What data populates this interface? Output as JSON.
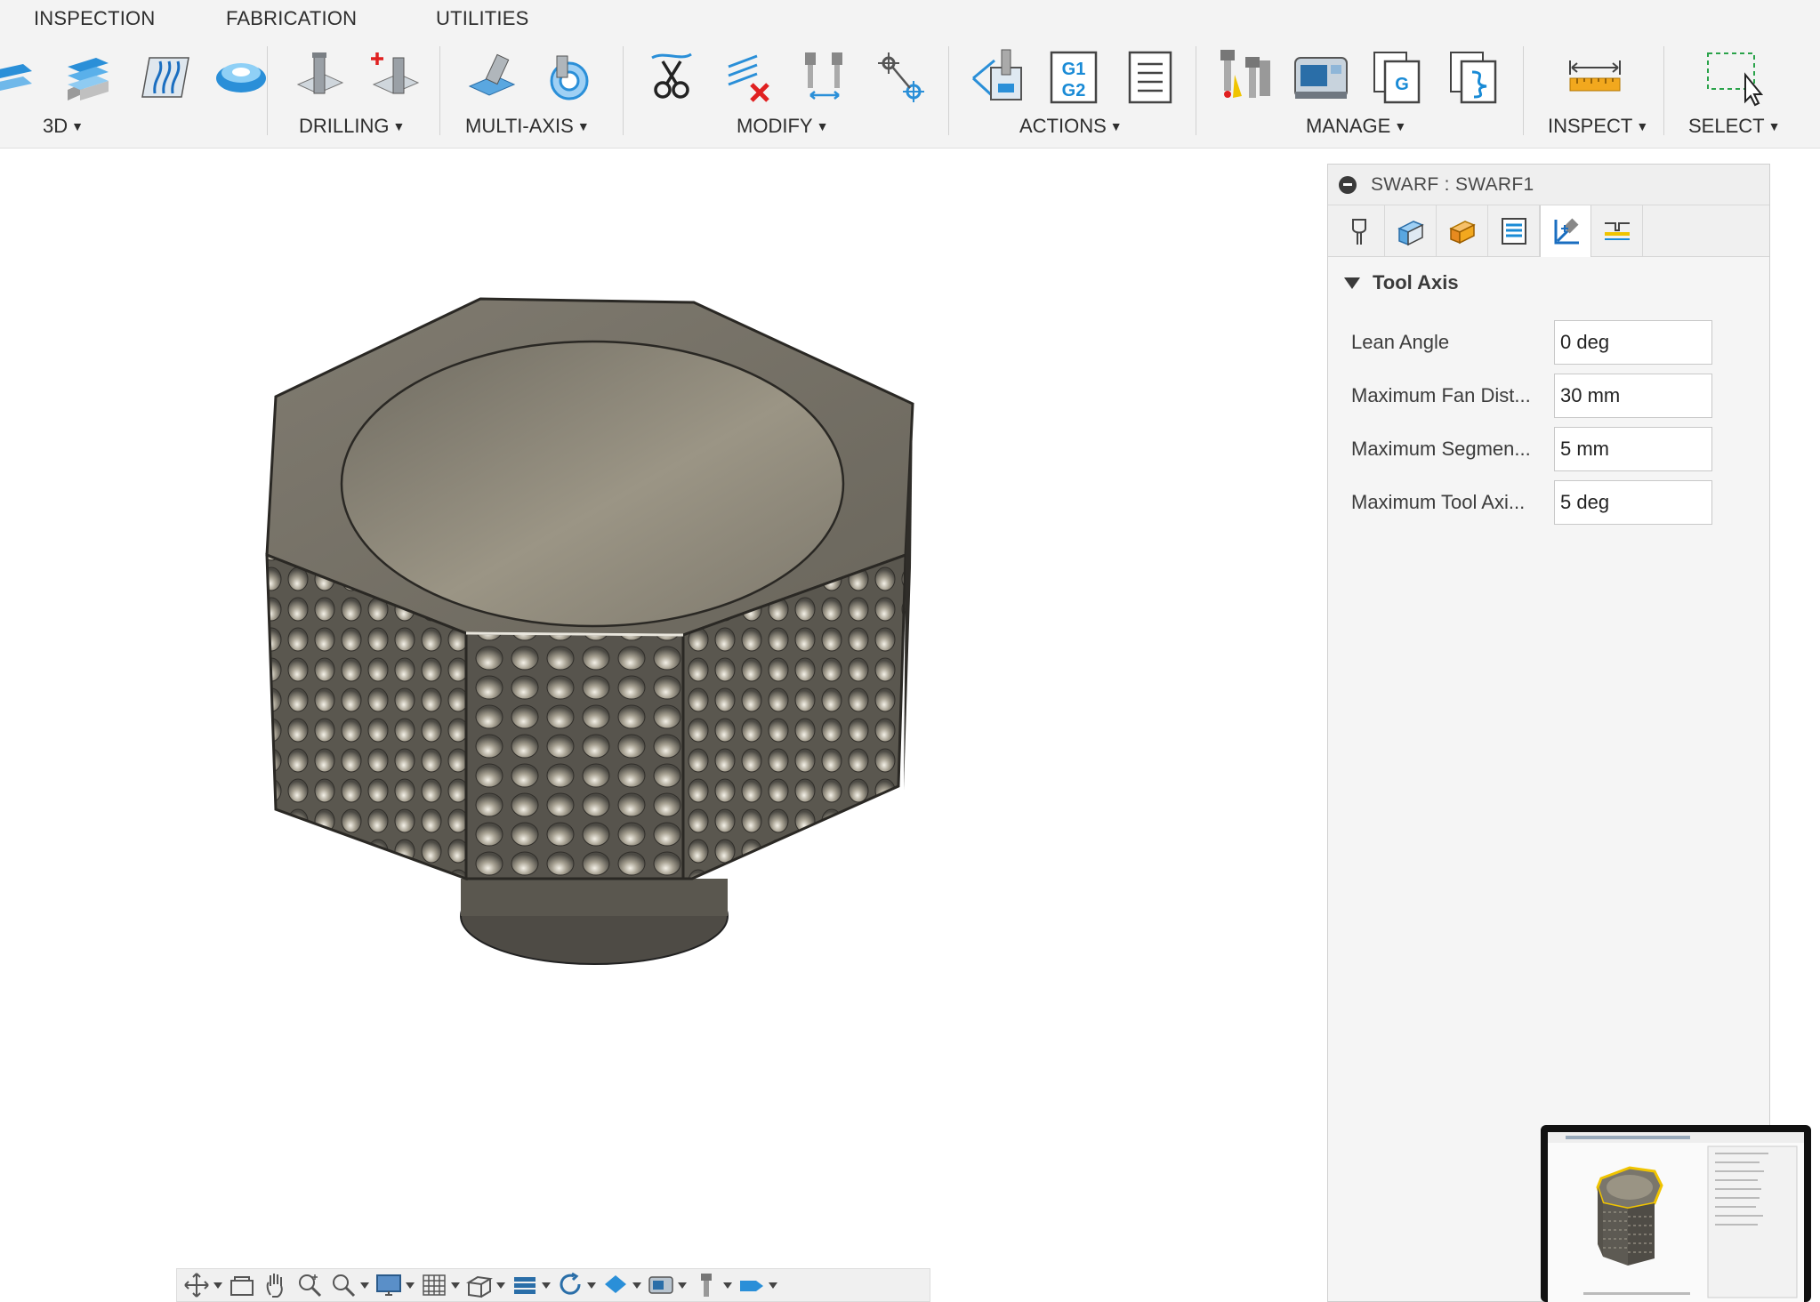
{
  "tabs": [
    "INSPECTION",
    "FABRICATION",
    "UTILITIES"
  ],
  "groups": {
    "g3d": "3D",
    "drilling": "DRILLING",
    "multiaxis": "MULTI-AXIS",
    "modify": "MODIFY",
    "actions": "ACTIONS",
    "manage": "MANAGE",
    "inspect": "INSPECT",
    "select": "SELECT"
  },
  "actions_g1g2": [
    "G1",
    "G2"
  ],
  "manage_g": "G",
  "panel": {
    "title": "SWARF : SWARF1",
    "section": "Tool Axis",
    "fields": [
      {
        "label": "Lean Angle",
        "value": "0 deg"
      },
      {
        "label": "Maximum Fan Dist...",
        "value": "30 mm"
      },
      {
        "label": "Maximum Segmen...",
        "value": "5 mm"
      },
      {
        "label": "Maximum Tool Axi...",
        "value": "5 deg"
      }
    ]
  },
  "colors": {
    "accent": "#1a8bd6",
    "model_dark": "#5d5a53",
    "model_light": "#9a9484",
    "highlight_yellow": "#f0c400"
  }
}
